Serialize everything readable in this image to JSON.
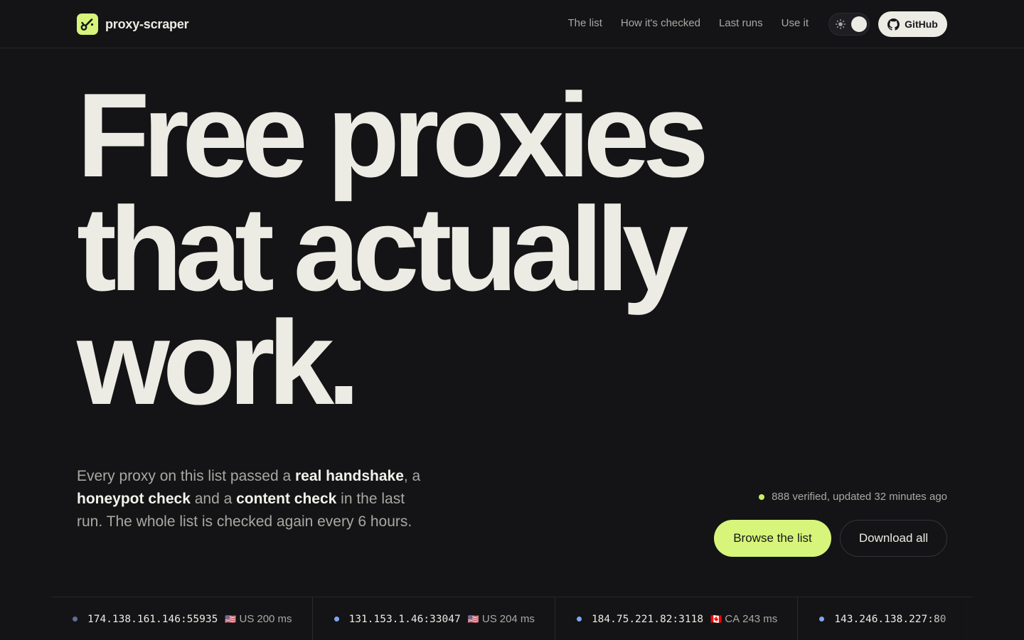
{
  "brand": {
    "name": "proxy-scraper"
  },
  "nav": [
    "The list",
    "How it's checked",
    "Last runs",
    "Use it"
  ],
  "github_label": "GitHub",
  "hero": {
    "lines": [
      "Free proxies",
      "that actually",
      "work."
    ]
  },
  "description": {
    "p1": "Every proxy on this list passed a ",
    "b1": "real handshake",
    "p2": ", a ",
    "b2": "honeypot check",
    "p3": " and a ",
    "b3": "content check",
    "p4": " in the last run. The whole list is checked again every 6 hours."
  },
  "status": {
    "text": "888 verified, updated 32 minutes ago"
  },
  "buttons": {
    "primary": "Browse the list",
    "secondary": "Download all"
  },
  "ticker": [
    {
      "addr": "174.138.161.146:55935",
      "flag": "🇺🇸",
      "country": "US",
      "latency": "200 ms",
      "dot_color": "#5b6f9c"
    },
    {
      "addr": "131.153.1.46:33047",
      "flag": "🇺🇸",
      "country": "US",
      "latency": "204 ms",
      "dot_color": "#7fa6f0"
    },
    {
      "addr": "184.75.221.82:3118",
      "flag": "🇨🇦",
      "country": "CA",
      "latency": "243 ms",
      "dot_color": "#7fa6f0"
    },
    {
      "addr": "143.246.138.227:80",
      "flag": "",
      "country": "",
      "latency": "",
      "dot_color": "#7fa6f0"
    }
  ],
  "colors": {
    "accent": "#d7f57a",
    "background": "#141416",
    "text": "#ecebe4",
    "muted": "#a9a8a2"
  }
}
